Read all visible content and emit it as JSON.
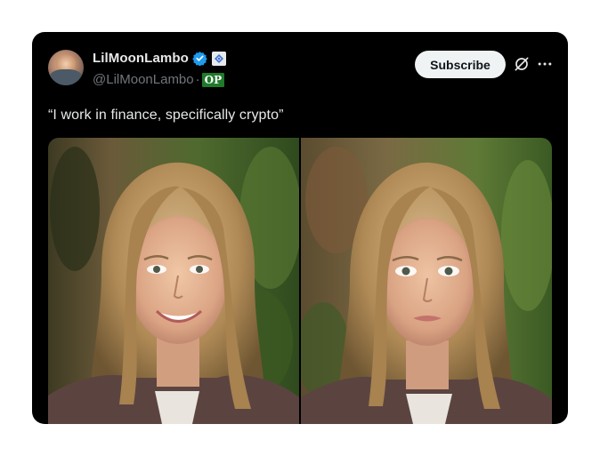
{
  "post": {
    "display_name": "LilMoonLambo",
    "handle": "@LilMoonLambo",
    "separator": "·",
    "op_badge": "OP",
    "subscribe_label": "Subscribe",
    "text": "“I work in finance, specifically crypto”"
  },
  "icons": {
    "verified": "verified-badge-icon",
    "affiliate": "affiliate-badge-icon",
    "grok": "grok-icon",
    "more": "more-dots-icon"
  },
  "media": [
    {
      "name": "photo-left",
      "expression": "smiling"
    },
    {
      "name": "photo-right",
      "expression": "neutral"
    }
  ],
  "colors": {
    "card_bg": "#000000",
    "text_primary": "#e7e9ea",
    "text_secondary": "#71767b",
    "verified_blue": "#1d9bf0",
    "op_green": "#1f7a2b",
    "button_bg": "#eff3f4"
  }
}
